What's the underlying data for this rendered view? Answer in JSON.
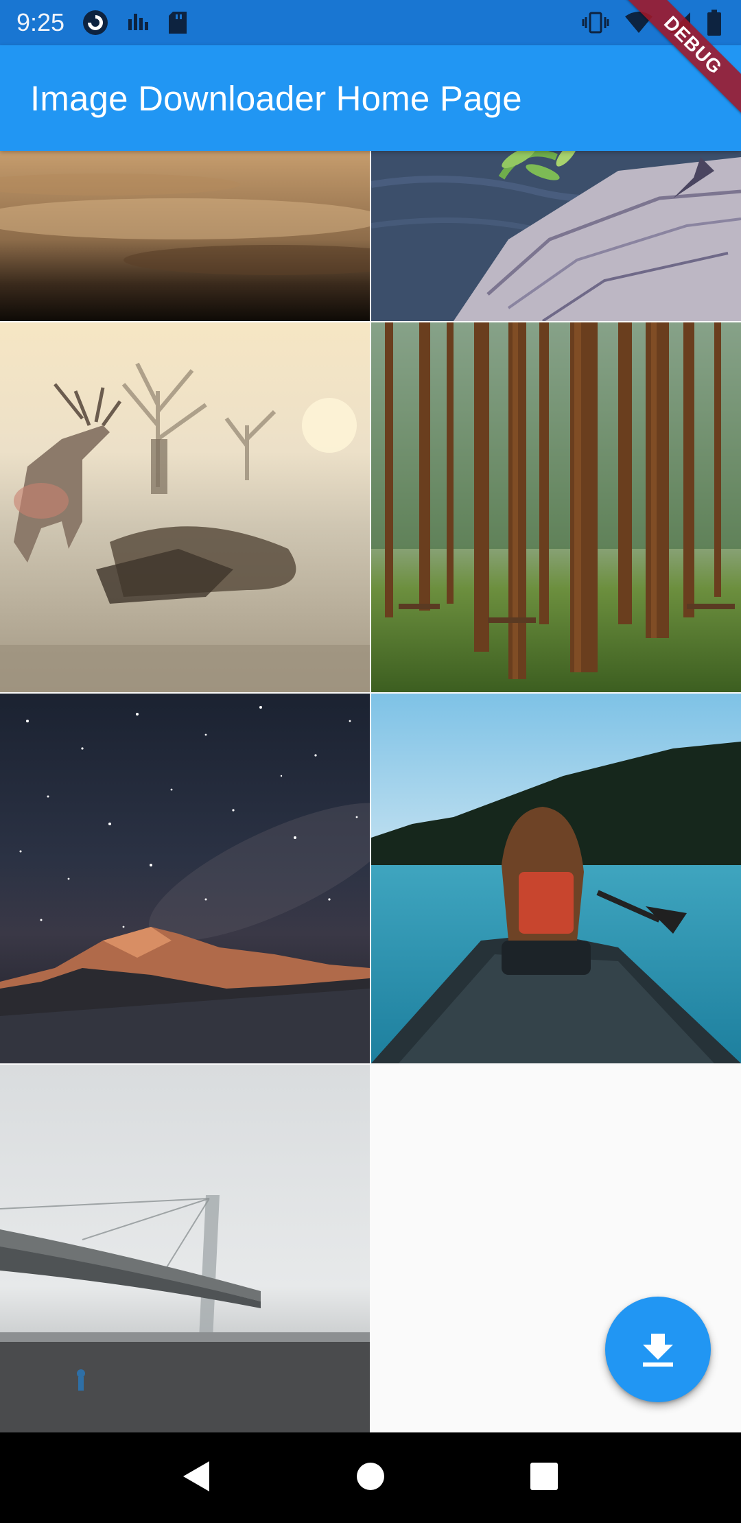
{
  "status_bar": {
    "time": "9:25",
    "icons": [
      "pocket-casts-icon",
      "signal-bars-app-icon",
      "sd-card-icon",
      "vibrate-icon",
      "wifi-icon",
      "cell-signal-icon",
      "battery-icon"
    ]
  },
  "app_bar": {
    "title": "Image Downloader Home Page",
    "color": "#2196f3"
  },
  "debug_banner": {
    "label": "DEBUG"
  },
  "grid": {
    "images": [
      {
        "subject": "sandy ground close-up"
      },
      {
        "subject": "log over water with green sprout"
      },
      {
        "subject": "stag deer in foggy field at sunrise"
      },
      {
        "subject": "tall pine forest with picnic tables"
      },
      {
        "subject": "starry night sky over snowy mountain"
      },
      {
        "subject": "woman in canoe on turquoise lake"
      },
      {
        "subject": "foggy suspension bridge over river"
      }
    ]
  },
  "fab": {
    "icon": "download-icon",
    "color": "#2196f3"
  },
  "nav_bar": {
    "buttons": [
      "back-icon",
      "home-icon",
      "recents-icon"
    ]
  }
}
